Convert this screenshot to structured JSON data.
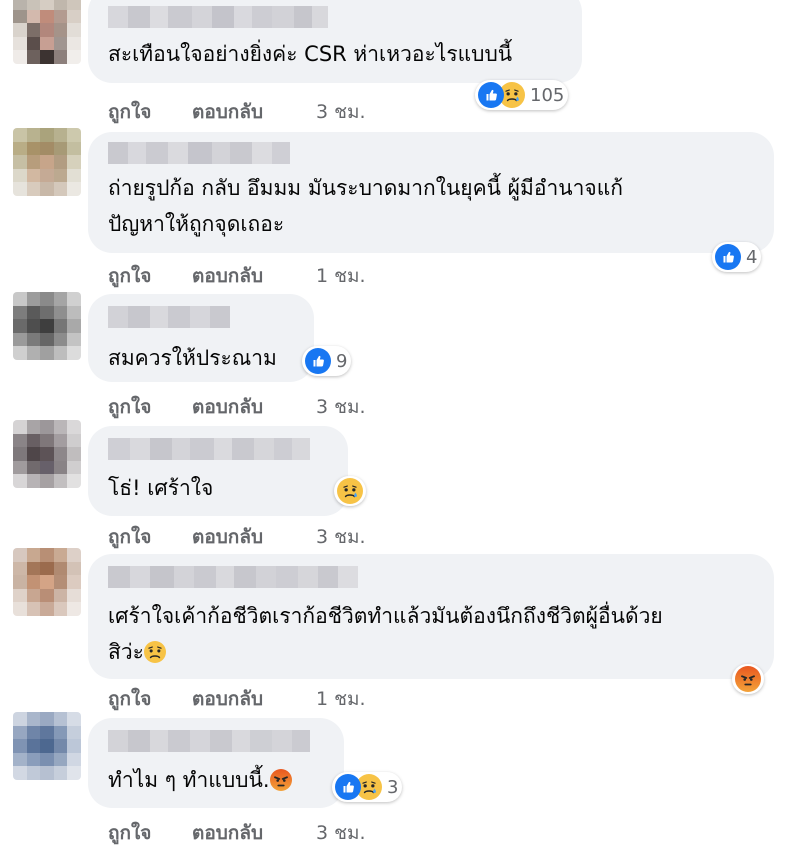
{
  "comments": [
    {
      "text_lines": [
        "สะเทือนใจอย่างยิ่งค่ะ CSR ห่าเหวอะไรแบบนี้"
      ],
      "actions": {
        "like": "ถูกใจ",
        "reply": "ตอบกลับ",
        "time": "3 ชม."
      },
      "reactions": {
        "icons": [
          "like-icon",
          "sad-icon"
        ],
        "count": "105"
      }
    },
    {
      "text_lines": [
        "ถ่ายรูปก้อ กลับ อึมมม มันระบาดมากในยุคนี้ ผู้มีอำนาจแก้",
        "ปัญหาให้ถูกจุดเถอะ"
      ],
      "actions": {
        "like": "ถูกใจ",
        "reply": "ตอบกลับ",
        "time": "1 ชม."
      },
      "reactions": {
        "icons": [
          "like-icon"
        ],
        "count": "4"
      }
    },
    {
      "text_lines": [
        "สมควรให้ประณาม"
      ],
      "actions": {
        "like": "ถูกใจ",
        "reply": "ตอบกลับ",
        "time": "3 ชม."
      },
      "reactions": {
        "icons": [
          "like-icon"
        ],
        "count": "9"
      }
    },
    {
      "text_lines": [
        "โธ่! เศร้าใจ"
      ],
      "actions": {
        "like": "ถูกใจ",
        "reply": "ตอบกลับ",
        "time": "3 ชม."
      },
      "reactions": {
        "icons": [
          "sad-icon"
        ],
        "count": ""
      }
    },
    {
      "text_lines": [
        "เศร้าใจเค้าก้อชีวิตเราก้อชีวิตทำแล้วมันต้องนึกถึงชีวิตผู้อื่นด้วย",
        "สิว่ะ"
      ],
      "actions": {
        "like": "ถูกใจ",
        "reply": "ตอบกลับ",
        "time": "1 ชม."
      },
      "reactions": {
        "icons": [
          "angry-icon"
        ],
        "count": ""
      }
    },
    {
      "text_lines": [
        "ทำไม ๆ ทำแบบนี้."
      ],
      "actions": {
        "like": "ถูกใจ",
        "reply": "ตอบกลับ",
        "time": "3 ชม."
      },
      "reactions": {
        "icons": [
          "like-icon",
          "sad-icon"
        ],
        "count": "3"
      }
    }
  ],
  "colors": {
    "bubble": "#f0f2f5",
    "like_blue": "#1877f2",
    "sad_yellow": "#f7c346",
    "angry_red": "#e9571f",
    "meta_gray": "#65676b"
  }
}
